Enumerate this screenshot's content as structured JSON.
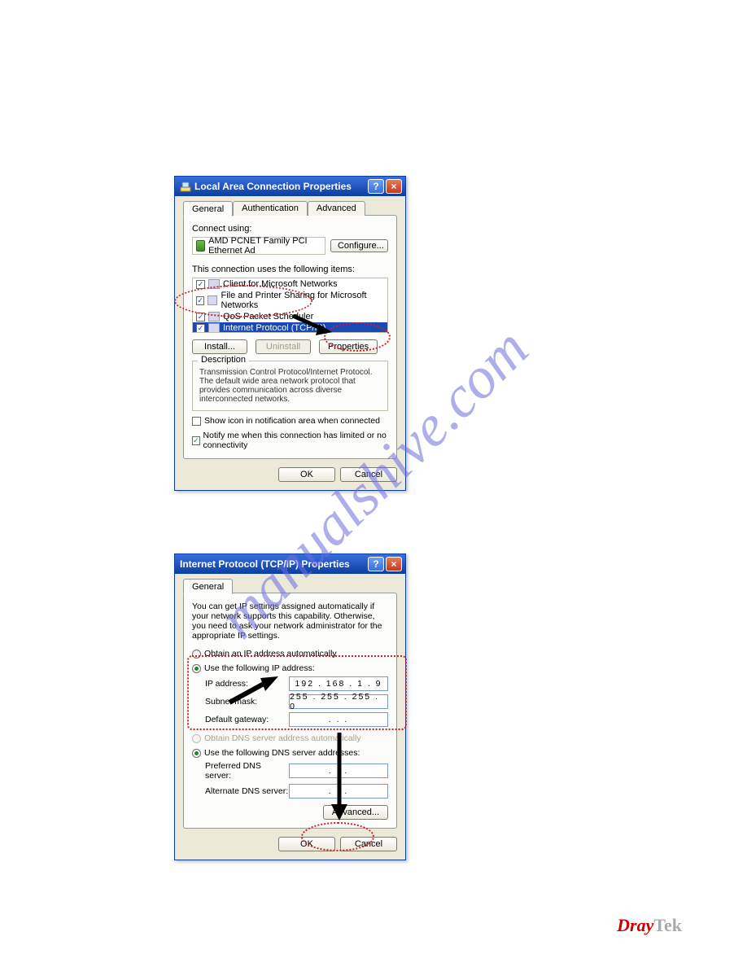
{
  "watermark": "manualshive.com",
  "brand_red": "Dray",
  "brand_gray": "Tek",
  "dialog1": {
    "title": "Local Area Connection Properties",
    "tabs": {
      "general": "General",
      "auth": "Authentication",
      "adv": "Advanced"
    },
    "connect_using_label": "Connect using:",
    "adapter": "AMD PCNET Family PCI Ethernet Ad",
    "configure_btn": "Configure...",
    "items_label": "This connection uses the following items:",
    "item0": "Client for Microsoft Networks",
    "item1": "File and Printer Sharing for Microsoft Networks",
    "item2": "QoS Packet Scheduler",
    "item3": "Internet Protocol (TCP/IP)",
    "install_btn": "Install...",
    "uninstall_btn": "Uninstall",
    "properties_btn": "Properties",
    "desc_legend": "Description",
    "desc_text": "Transmission Control Protocol/Internet Protocol. The default wide area network protocol that provides communication across diverse interconnected networks.",
    "chk_icon": "Show icon in notification area when connected",
    "chk_notify": "Notify me when this connection has limited or no connectivity",
    "ok_btn": "OK",
    "cancel_btn": "Cancel"
  },
  "dialog2": {
    "title": "Internet Protocol (TCP/IP) Properties",
    "tab_general": "General",
    "intro": "You can get IP settings assigned automatically if your network supports this capability. Otherwise, you need to ask your network administrator for the appropriate IP settings.",
    "radio_auto": "Obtain an IP address automatically",
    "radio_use_ip": "Use the following IP address:",
    "ip_label": "IP address:",
    "ip_value": "192 . 168 .  1  .  9",
    "subnet_label": "Subnet mask:",
    "subnet_value": "255 . 255 . 255 .  0",
    "gateway_label": "Default gateway:",
    "gateway_value": ".        .        .",
    "radio_auto_dns": "Obtain DNS server address automatically",
    "radio_use_dns": "Use the following DNS server addresses:",
    "pref_dns_label": "Preferred DNS server:",
    "pref_dns_value": ".        .        .",
    "alt_dns_label": "Alternate DNS server:",
    "alt_dns_value": ".        .        .",
    "advanced_btn": "Advanced...",
    "ok_btn": "OK",
    "cancel_btn": "Cancel"
  }
}
